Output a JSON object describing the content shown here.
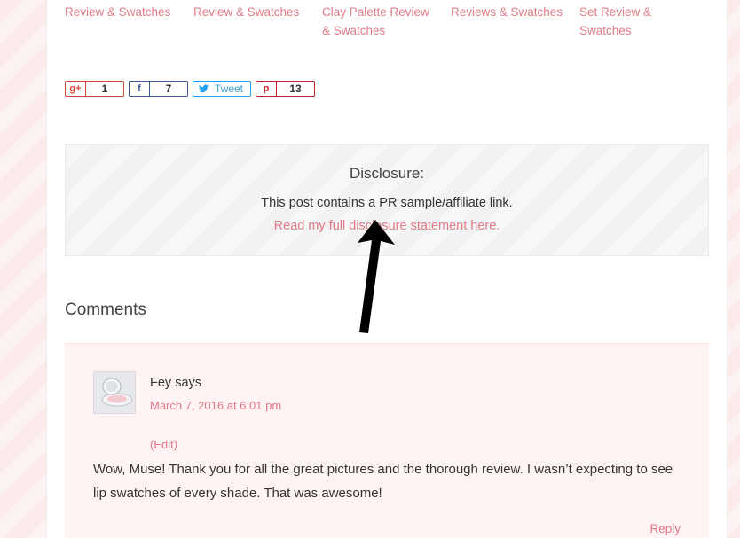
{
  "related_posts": [
    {
      "title": "Review & Swatches"
    },
    {
      "title": "Review & Swatches"
    },
    {
      "title": "Clay Palette Review & Swatches"
    },
    {
      "title": "Reviews & Swatches"
    },
    {
      "title": "Set Review & Swatches"
    }
  ],
  "share": {
    "gplus": {
      "icon": "g+",
      "count": "1"
    },
    "facebook": {
      "icon": "f",
      "count": "7"
    },
    "twitter": {
      "icon": "twitter-bird",
      "label": "Tweet"
    },
    "pinterest": {
      "icon": "p",
      "count": "13"
    }
  },
  "disclosure": {
    "title": "Disclosure:",
    "text": "This post contains a PR sample/affiliate link.",
    "link": "Read my full disclosure statement here."
  },
  "comments": {
    "heading": "Comments",
    "items": [
      {
        "author": "Fey says",
        "date": "March 7, 2016 at 6:01 pm",
        "edit": "(Edit)",
        "body": "Wow, Muse! Thank you for all the great pictures and the thorough review. I wasn’t expecting to see lip swatches of every shade. That was awesome!",
        "reply": "Reply"
      }
    ]
  },
  "colors": {
    "accent": "#e07a86",
    "comment_bg": "#fff3f3",
    "page_bg": "#fdf1f1"
  }
}
